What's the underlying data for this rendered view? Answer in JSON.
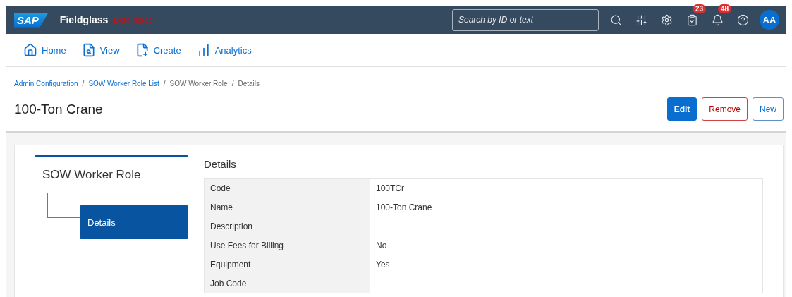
{
  "header": {
    "logo": "SAP",
    "product": "Fieldglass",
    "mode": "Beta Mode",
    "search": {
      "placeholder": "Search by ID or text"
    },
    "icons": [
      {
        "kind": "search"
      },
      {
        "kind": "sliders"
      },
      {
        "kind": "settings"
      },
      {
        "kind": "tasks",
        "badge": "23"
      },
      {
        "kind": "bell",
        "badge": "48"
      },
      {
        "kind": "help"
      }
    ],
    "avatar": "AA"
  },
  "nav": [
    {
      "kind": "home",
      "label": "Home"
    },
    {
      "kind": "view",
      "label": "View"
    },
    {
      "kind": "create",
      "label": "Create"
    },
    {
      "kind": "analytics",
      "label": "Analytics"
    }
  ],
  "breadcrumb_separator": "/",
  "breadcrumb": [
    {
      "label": "Admin Configuration",
      "kind": "link"
    },
    {
      "label": "SOW Worker Role List",
      "kind": "link"
    },
    {
      "label": "SOW Worker Role",
      "kind": "text"
    },
    {
      "label": "Details",
      "kind": "text"
    }
  ],
  "title": "100-Ton Crane",
  "actions": [
    {
      "label": "Edit",
      "kind": "primary"
    },
    {
      "label": "Remove",
      "kind": "danger"
    },
    {
      "label": "New",
      "kind": "secondary"
    }
  ],
  "tree": {
    "label": "SOW Worker Role",
    "selected": false,
    "children": [
      {
        "label": "Details",
        "selected": true
      }
    ]
  },
  "details": {
    "title": "Details",
    "rows": [
      {
        "label": "Code",
        "value": "100TCr"
      },
      {
        "label": "Name",
        "value": "100-Ton Crane"
      },
      {
        "label": "Description",
        "value": ""
      },
      {
        "label": "Use Fees for Billing",
        "value": "No"
      },
      {
        "label": "Equipment",
        "value": "Yes"
      },
      {
        "label": "Job Code",
        "value": ""
      }
    ]
  }
}
